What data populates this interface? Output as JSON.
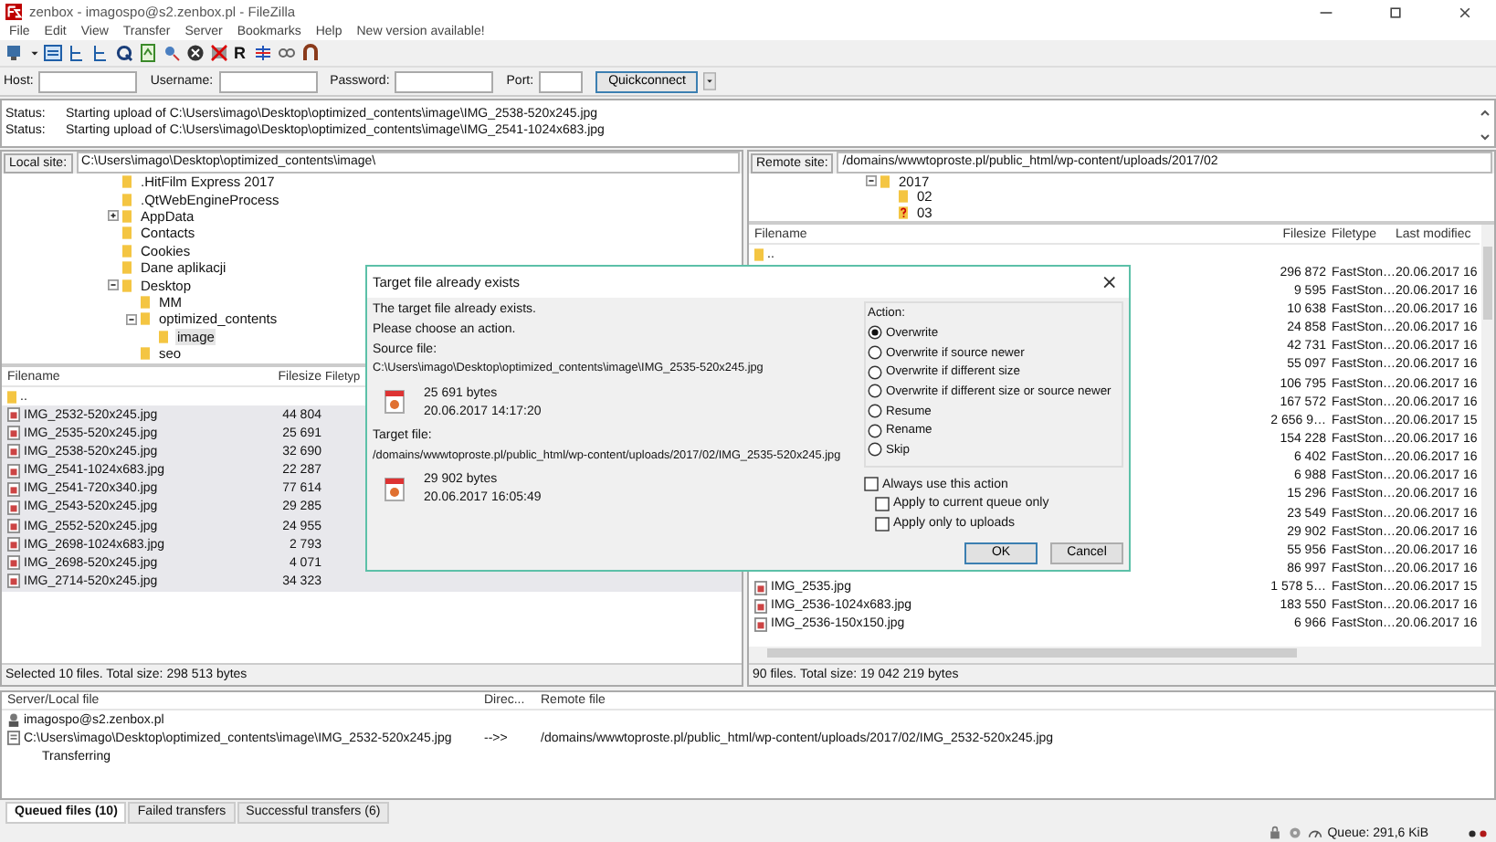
{
  "window": {
    "title": "zenbox - imagospo@s2.zenbox.pl - FileZilla"
  },
  "menu": [
    "File",
    "Edit",
    "View",
    "Transfer",
    "Server",
    "Bookmarks",
    "Help",
    "New version available!"
  ],
  "toolbar": {
    "reconnect_glyph": "R"
  },
  "quickconnect": {
    "host_label": "Host:",
    "username_label": "Username:",
    "password_label": "Password:",
    "port_label": "Port:",
    "button": "Quickconnect"
  },
  "log": [
    {
      "label": "Status:",
      "message": "Starting upload of C:\\Users\\imago\\Desktop\\optimized_contents\\image\\IMG_2538-520x245.jpg"
    },
    {
      "label": "Status:",
      "message": "Starting upload of C:\\Users\\imago\\Desktop\\optimized_contents\\image\\IMG_2541-1024x683.jpg"
    }
  ],
  "local": {
    "site_label": "Local site:",
    "path": "C:\\Users\\imago\\Desktop\\optimized_contents\\image\\",
    "tree": [
      {
        "name": ".HitFilm Express 2017",
        "selected": false
      },
      {
        "name": ".QtWebEngineProcess",
        "selected": false
      },
      {
        "name": "AppData",
        "selected": false,
        "expanded": false
      },
      {
        "name": "Contacts",
        "selected": false
      },
      {
        "name": "Cookies",
        "selected": false
      },
      {
        "name": "Dane aplikacji",
        "selected": false
      },
      {
        "name": "Desktop",
        "selected": false,
        "expanded": true,
        "children": [
          {
            "name": "MM",
            "selected": false
          },
          {
            "name": "optimized_contents",
            "selected": false,
            "expanded": true,
            "children": [
              {
                "name": "image",
                "selected": true
              }
            ]
          },
          {
            "name": "seo",
            "selected": false
          }
        ]
      }
    ],
    "columns": [
      "Filename",
      "Filesize",
      "Filetyp"
    ],
    "rows": [
      {
        "name": "..",
        "kind": "folder",
        "selected": false
      },
      {
        "name": "IMG_2532-520x245.jpg",
        "size": "44 804",
        "kind": "file",
        "selected": true
      },
      {
        "name": "IMG_2535-520x245.jpg",
        "size": "25 691",
        "kind": "file",
        "selected": true
      },
      {
        "name": "IMG_2538-520x245.jpg",
        "size": "32 690",
        "kind": "file",
        "selected": true
      },
      {
        "name": "IMG_2541-1024x683.jpg",
        "size": "22 287",
        "kind": "file",
        "selected": true
      },
      {
        "name": "IMG_2541-720x340.jpg",
        "size": "77 614",
        "kind": "file",
        "selected": true
      },
      {
        "name": "IMG_2543-520x245.jpg",
        "size": "29 285",
        "kind": "file",
        "selected": true
      },
      {
        "name": "IMG_2552-520x245.jpg",
        "size": "24 955",
        "kind": "file",
        "selected": true
      },
      {
        "name": "IMG_2698-1024x683.jpg",
        "size": "2 793",
        "kind": "file",
        "selected": true
      },
      {
        "name": "IMG_2698-520x245.jpg",
        "size": "4 071",
        "kind": "file",
        "selected": true
      },
      {
        "name": "IMG_2714-520x245.jpg",
        "size": "34 323",
        "kind": "file",
        "selected": true
      }
    ],
    "status": "Selected 10 files. Total size: 298 513 bytes"
  },
  "remote": {
    "site_label": "Remote site:",
    "path": "/domains/wwwtoproste.pl/public_html/wp-content/uploads/2017/02",
    "tree": [
      {
        "name": "2017",
        "kind": "folder",
        "expanded": true,
        "children": [
          {
            "name": "02",
            "kind": "folder"
          },
          {
            "name": "03",
            "kind": "unknown"
          }
        ]
      }
    ],
    "columns": [
      "Filename",
      "Filesize",
      "Filetype",
      "Last modifiec"
    ],
    "rows": [
      {
        "name": "..",
        "kind": "folder"
      },
      {
        "size": "296 872",
        "type": "FastSton…",
        "modified": "20.06.2017 16"
      },
      {
        "size": "9 595",
        "type": "FastSton…",
        "modified": "20.06.2017 16"
      },
      {
        "size": "10 638",
        "type": "FastSton…",
        "modified": "20.06.2017 16"
      },
      {
        "size": "24 858",
        "type": "FastSton…",
        "modified": "20.06.2017 16"
      },
      {
        "size": "42 731",
        "type": "FastSton…",
        "modified": "20.06.2017 16"
      },
      {
        "size": "55 097",
        "type": "FastSton…",
        "modified": "20.06.2017 16"
      },
      {
        "size": "106 795",
        "type": "FastSton…",
        "modified": "20.06.2017 16"
      },
      {
        "size": "167 572",
        "type": "FastSton…",
        "modified": "20.06.2017 16"
      },
      {
        "size": "2 656 9…",
        "type": "FastSton…",
        "modified": "20.06.2017 15"
      },
      {
        "size": "154 228",
        "type": "FastSton…",
        "modified": "20.06.2017 16"
      },
      {
        "size": "6 402",
        "type": "FastSton…",
        "modified": "20.06.2017 16"
      },
      {
        "size": "6 988",
        "type": "FastSton…",
        "modified": "20.06.2017 16"
      },
      {
        "size": "15 296",
        "type": "FastSton…",
        "modified": "20.06.2017 16"
      },
      {
        "size": "23 549",
        "type": "FastSton…",
        "modified": "20.06.2017 16"
      },
      {
        "size": "29 902",
        "type": "FastSton…",
        "modified": "20.06.2017 16"
      },
      {
        "size": "55 956",
        "type": "FastSton…",
        "modified": "20.06.2017 16"
      },
      {
        "size": "86 997",
        "type": "FastSton…",
        "modified": "20.06.2017 16"
      },
      {
        "name": "IMG_2535.jpg",
        "kind": "file",
        "size": "1 578 5…",
        "type": "FastSton…",
        "modified": "20.06.2017 15"
      },
      {
        "name": "IMG_2536-1024x683.jpg",
        "kind": "file",
        "size": "183 550",
        "type": "FastSton…",
        "modified": "20.06.2017 16"
      },
      {
        "name": "IMG_2536-150x150.jpg",
        "kind": "file",
        "size": "6 966",
        "type": "FastSton…",
        "modified": "20.06.2017 16"
      }
    ],
    "status": "90 files. Total size: 19 042 219 bytes"
  },
  "queue": {
    "columns": [
      "Server/Local file",
      "Direc...",
      "Remote file"
    ],
    "server": "imagospo@s2.zenbox.pl",
    "items": [
      {
        "local": "C:\\Users\\imago\\Desktop\\optimized_contents\\image\\IMG_2532-520x245.jpg",
        "direction": "-->>",
        "remote": "/domains/wwwtoproste.pl/public_html/wp-content/uploads/2017/02/IMG_2532-520x245.jpg",
        "state": "Transferring"
      }
    ],
    "tabs": [
      {
        "label": "Queued files (10)",
        "selected": true
      },
      {
        "label": "Failed transfers",
        "selected": false
      },
      {
        "label": "Successful transfers (6)",
        "selected": false
      }
    ],
    "queue_size": "Queue: 291,6 KiB"
  },
  "dialog": {
    "title": "Target file already exists",
    "close": "×",
    "message": [
      "The target file already exists.",
      "Please choose an action."
    ],
    "source": {
      "label": "Source file:",
      "path": "C:\\Users\\imago\\Desktop\\optimized_contents\\image\\IMG_2535-520x245.jpg",
      "size": "25 691 bytes",
      "date": "20.06.2017 14:17:20"
    },
    "target": {
      "label": "Target file:",
      "path": "/domains/wwwtoproste.pl/public_html/wp-content/uploads/2017/02/IMG_2535-520x245.jpg",
      "size": "29 902 bytes",
      "date": "20.06.2017 16:05:49"
    },
    "action_label": "Action:",
    "actions": [
      {
        "label": "Overwrite",
        "selected": true
      },
      {
        "label": "Overwrite if source newer",
        "selected": false
      },
      {
        "label": "Overwrite if different size",
        "selected": false
      },
      {
        "label": "Overwrite if different size or source newer",
        "selected": false
      },
      {
        "label": "Resume",
        "selected": false
      },
      {
        "label": "Rename",
        "selected": false
      },
      {
        "label": "Skip",
        "selected": false
      }
    ],
    "options": [
      {
        "label": "Always use this action",
        "checked": false,
        "children": [
          {
            "label": "Apply to current queue only",
            "checked": false
          },
          {
            "label": "Apply only to uploads",
            "checked": false
          }
        ]
      }
    ],
    "buttons": [
      {
        "label": "OK",
        "kind": "default"
      },
      {
        "label": "Cancel",
        "kind": "normal"
      }
    ]
  }
}
